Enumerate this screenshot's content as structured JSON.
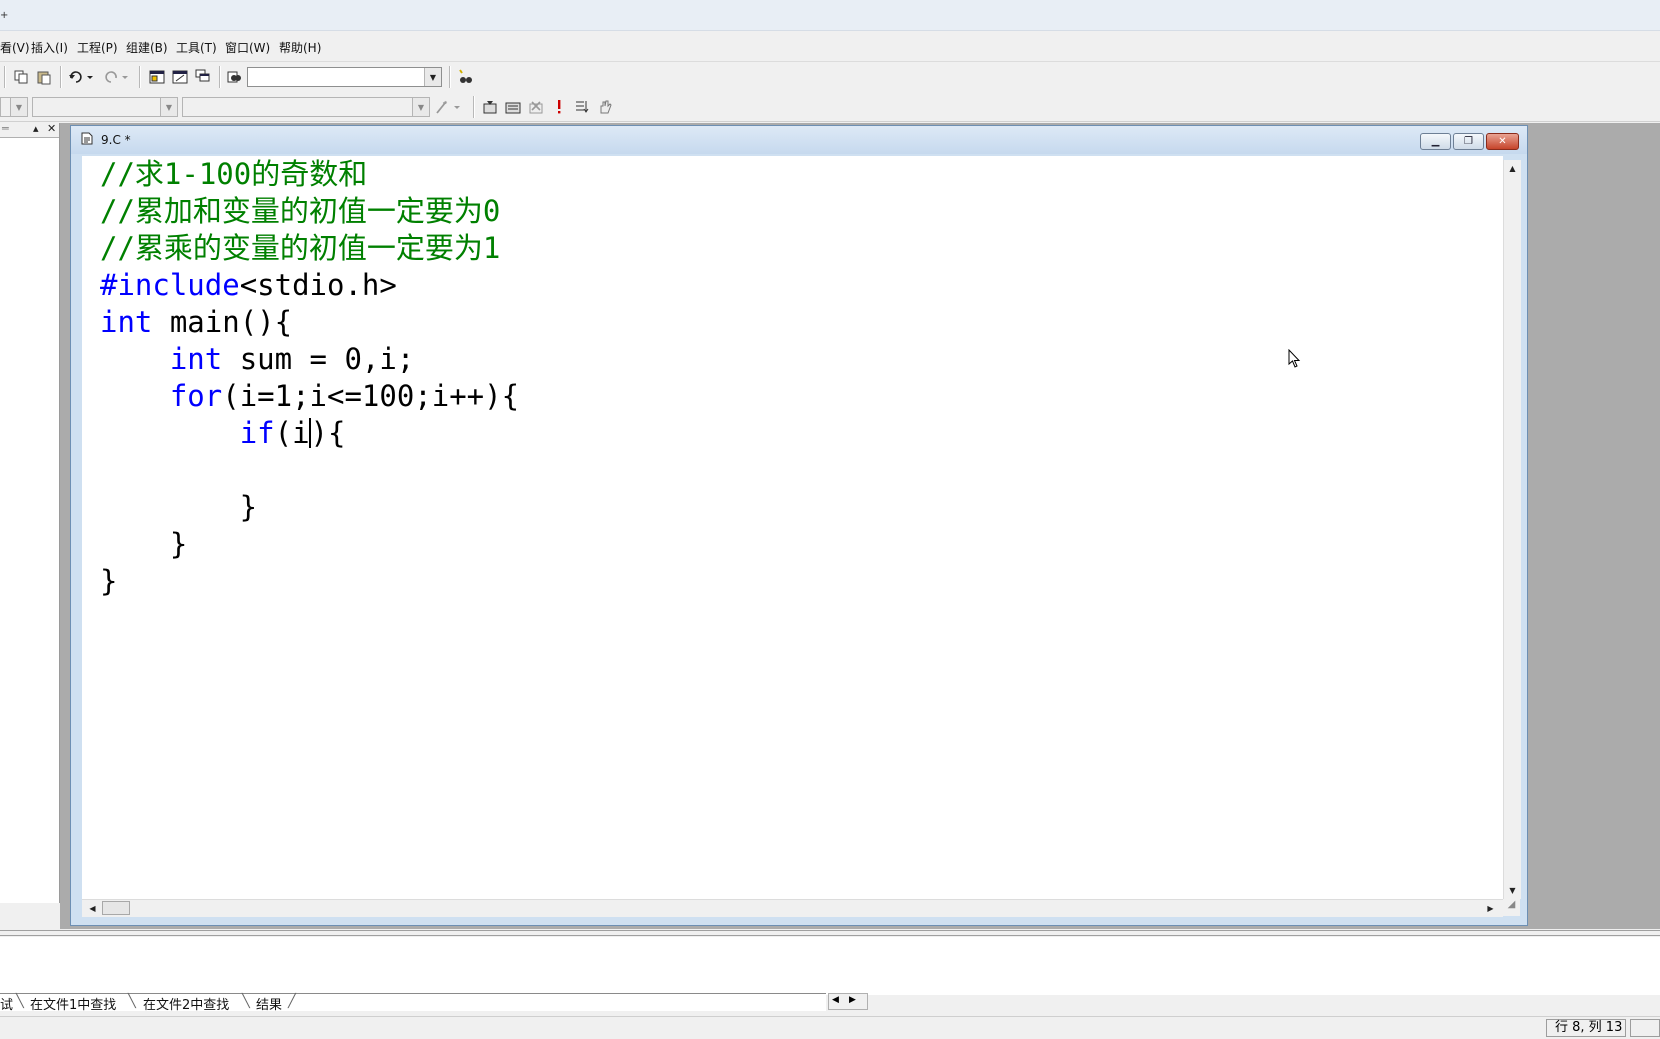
{
  "menu": {
    "items": [
      "看(V)",
      "插入(I)",
      "工程(P)",
      "组建(B)",
      "工具(T)",
      "窗口(W)",
      "帮助(H)"
    ]
  },
  "toolbar": {
    "find_combo_value": "",
    "class_combo_value": "",
    "member_combo_value": ""
  },
  "icons": {
    "copy": "copy-icon",
    "paste": "paste-icon",
    "undo": "undo-icon",
    "redo": "redo-icon",
    "workspace": "workspace-icon",
    "output": "output-window-icon",
    "windows": "window-list-icon",
    "find_in_files": "find-in-files-icon",
    "find": "find-icon",
    "wizard": "wizard-icon",
    "compile": "compile-icon",
    "build": "build-icon",
    "stop": "stop-build-icon",
    "run": "execute-icon",
    "go": "go-icon",
    "breakpoint": "breakpoint-hand-icon"
  },
  "document": {
    "title": "9.C *",
    "code_lines": [
      [
        {
          "t": "//求1-100的奇数和",
          "c": "cm"
        }
      ],
      [
        {
          "t": "//累加和变量的初值一定要为0",
          "c": "cm"
        }
      ],
      [
        {
          "t": "//累乘的变量的初值一定要为1",
          "c": "cm"
        }
      ],
      [
        {
          "t": "#include",
          "c": "pp"
        },
        {
          "t": "<stdio.h>",
          "c": "tx"
        }
      ],
      [
        {
          "t": "int",
          "c": "kw"
        },
        {
          "t": " main(){",
          "c": "tx"
        }
      ],
      [
        {
          "t": "    ",
          "c": "tx"
        },
        {
          "t": "int",
          "c": "kw"
        },
        {
          "t": " sum = 0,i;",
          "c": "tx"
        }
      ],
      [
        {
          "t": "    ",
          "c": "tx"
        },
        {
          "t": "for",
          "c": "kw"
        },
        {
          "t": "(i=1;i<=100;i++){",
          "c": "tx"
        }
      ],
      [
        {
          "t": "        ",
          "c": "tx"
        },
        {
          "t": "if",
          "c": "kw"
        },
        {
          "t": "(i",
          "c": "tx"
        },
        {
          "t": "",
          "c": "caret"
        },
        {
          "t": "){",
          "c": "tx"
        }
      ],
      [
        {
          "t": "",
          "c": "tx"
        }
      ],
      [
        {
          "t": "        }",
          "c": "tx"
        }
      ],
      [
        {
          "t": "    }",
          "c": "tx"
        }
      ],
      [
        {
          "t": "}",
          "c": "tx"
        }
      ]
    ]
  },
  "output": {
    "tabs": [
      "试",
      "在文件1中查找",
      "在文件2中查找",
      "结果"
    ]
  },
  "status": {
    "position": "行 8, 列 13"
  },
  "colors": {
    "comment": "#008000",
    "keyword": "#0000ff",
    "mdi_background": "#ababab"
  }
}
